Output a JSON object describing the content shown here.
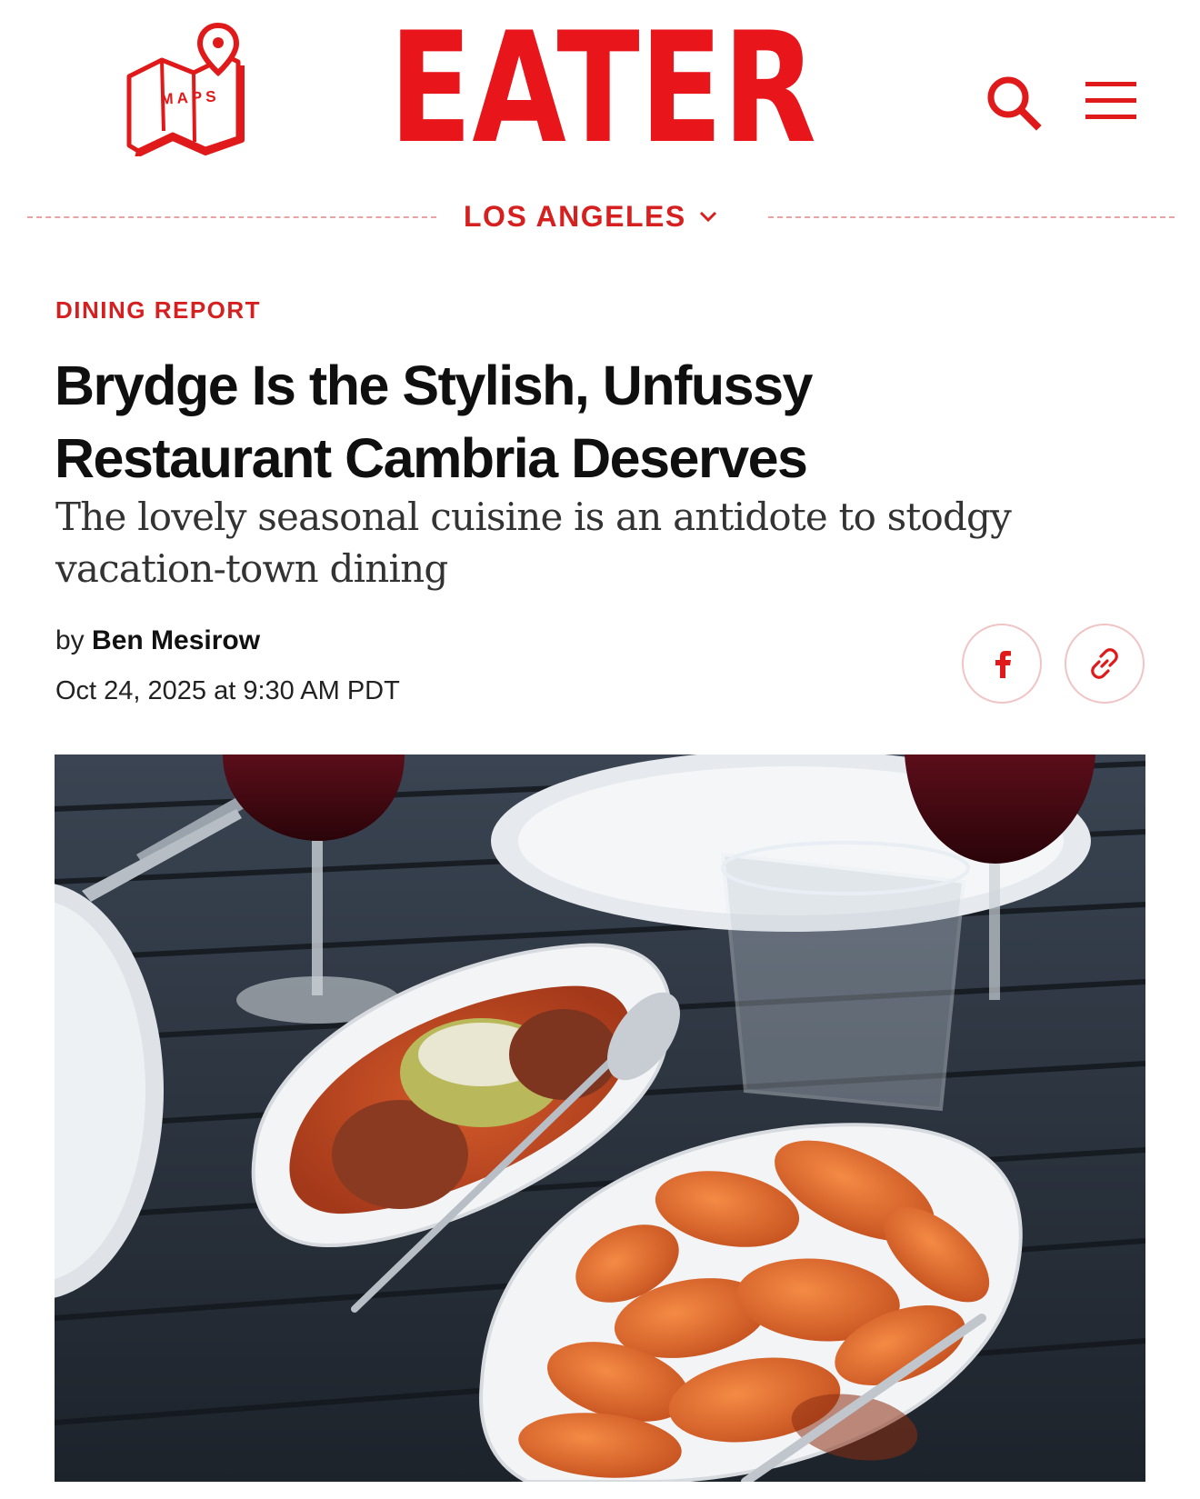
{
  "header": {
    "maps_label": "MAPS",
    "logo_text": "EATER",
    "brand_color": "#e8151b"
  },
  "icons": {
    "maps": "map-pin-icon",
    "search": "search-icon",
    "menu": "hamburger-menu-icon",
    "dropdown": "chevron-down-icon",
    "facebook": "facebook-icon",
    "link": "link-icon"
  },
  "region": {
    "label": "LOS ANGELES",
    "accent": "#d61f1f"
  },
  "article": {
    "kicker": "DINING REPORT",
    "headline_line1": "Brydge Is the Stylish, Unfussy",
    "headline_line2": "Restaurant Cambria Deserves",
    "dek_line1": "The lovely seasonal cuisine is an antidote to stodgy",
    "dek_line2": "vacation-town dining",
    "byline_prefix": "by",
    "author": "Ben Mesirow",
    "timestamp": "Oct 24, 2025 at 9:30 AM PDT"
  }
}
